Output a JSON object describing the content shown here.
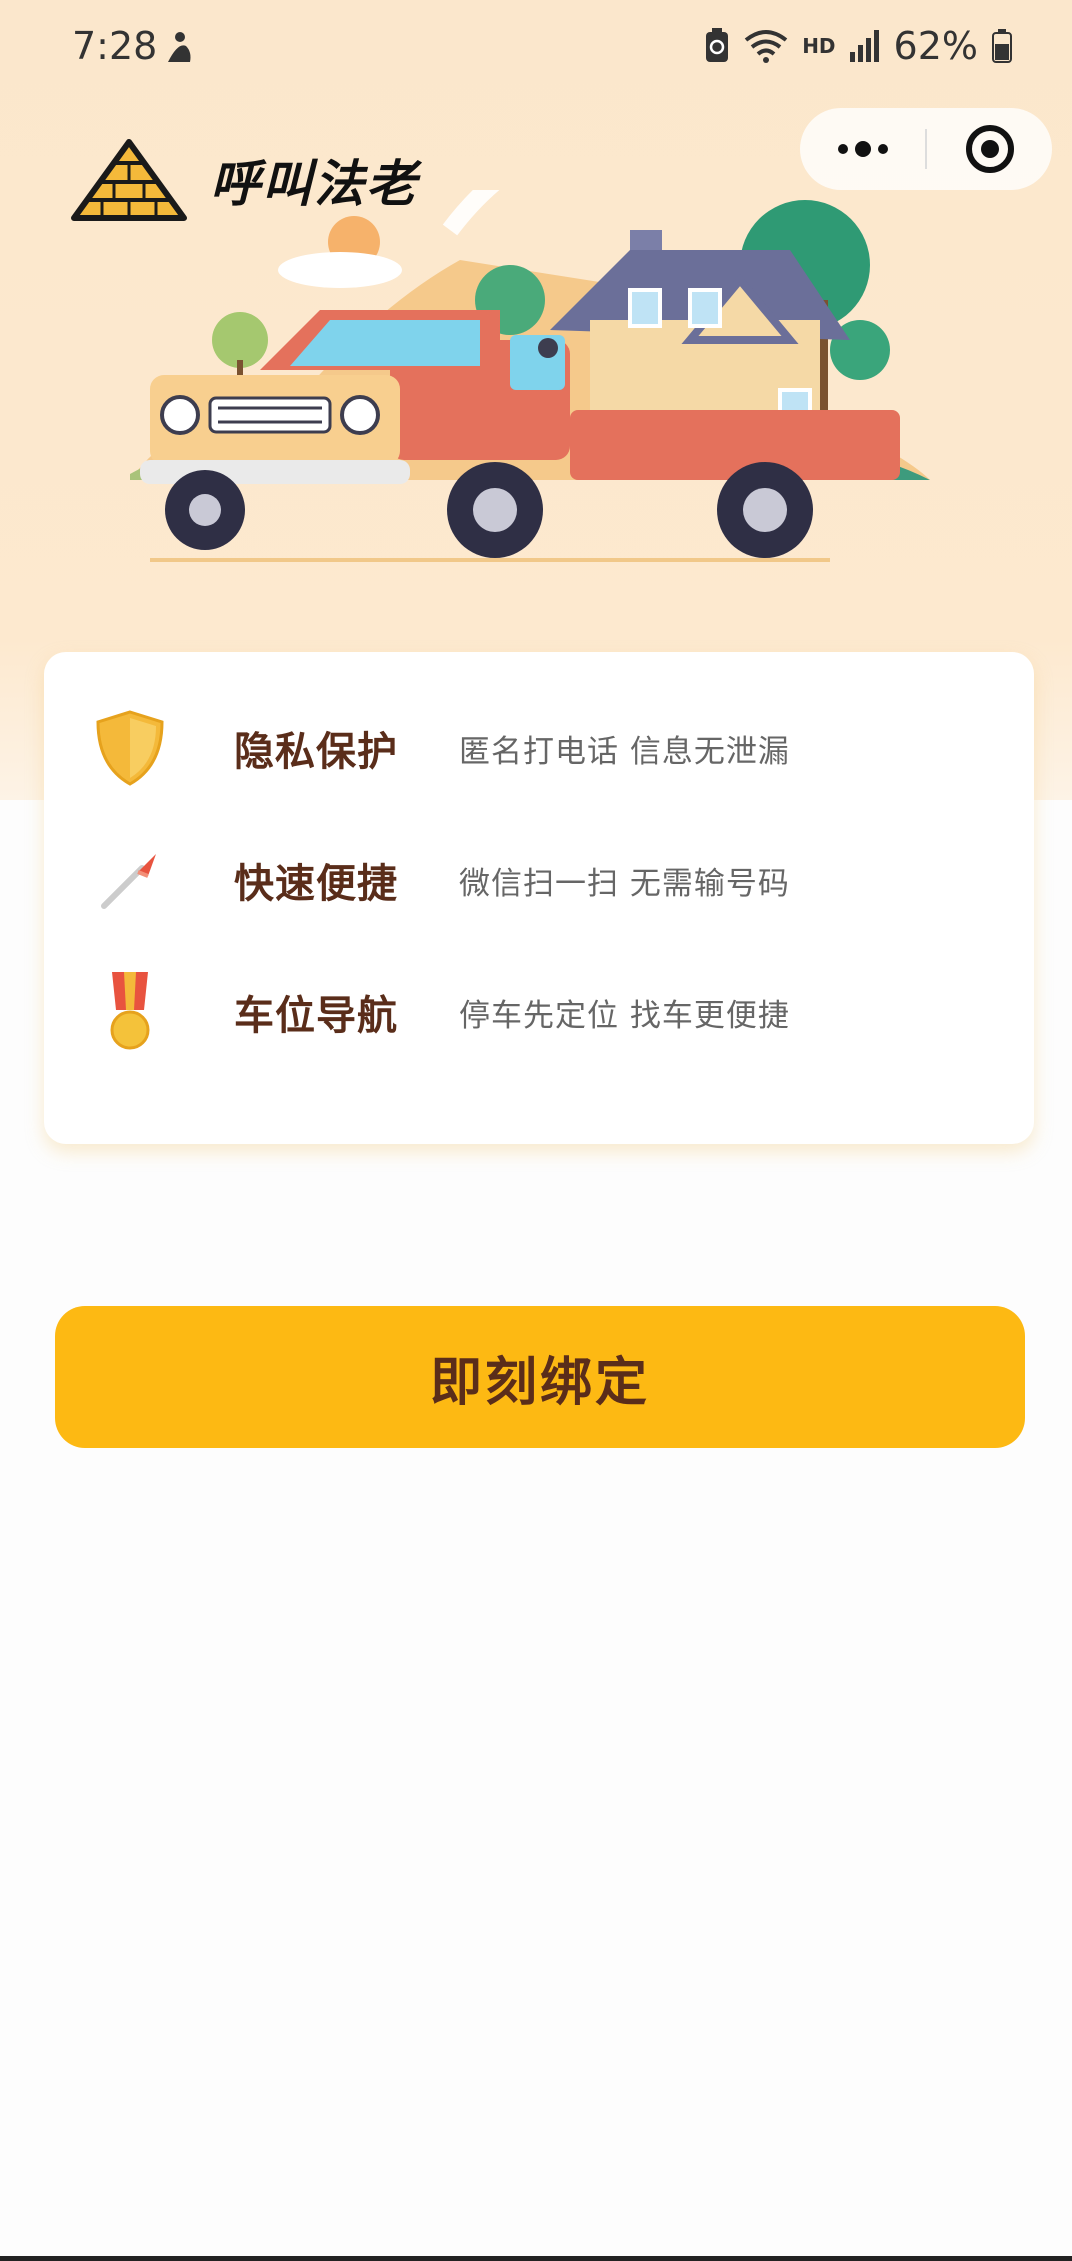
{
  "status_bar": {
    "time": "7:28",
    "network": "HD",
    "battery": "62%",
    "icons": [
      "person-icon",
      "recycle-icon",
      "wifi-icon",
      "signal-icon",
      "battery-icon"
    ]
  },
  "header": {
    "app_title": "呼叫法老",
    "logo_icon": "pyramid-icon",
    "capsule_icons": [
      "more-dots-icon",
      "target-icon"
    ]
  },
  "features": [
    {
      "title": "隐私保护",
      "desc": "匿名打电话  信息无泄漏",
      "icon": "shield-icon"
    },
    {
      "title": "快速便捷",
      "desc": "微信扫一扫  无需输号码",
      "icon": "rocket-icon"
    },
    {
      "title": "车位导航",
      "desc": "停车先定位  找车更便捷",
      "icon": "medal-icon"
    }
  ],
  "actions": {
    "bind_label": "即刻绑定"
  },
  "colors": {
    "accent": "#fdb913",
    "title_brown": "#5a2d1a",
    "hero_bg": "#fbe7cc"
  }
}
